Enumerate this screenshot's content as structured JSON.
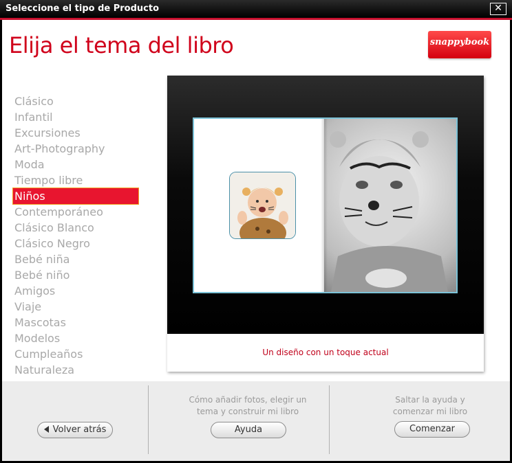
{
  "window": {
    "title": "Seleccione el tipo de Producto",
    "close_glyph": "✕"
  },
  "header": {
    "heading": "Elija el tema del libro",
    "logo_text": "snappybook"
  },
  "themes": {
    "items": [
      "Clásico",
      "Infantil",
      "Excursiones",
      "Art-Photography",
      "Moda",
      "Tiempo libre",
      "Niños",
      "Contemporáneo",
      "Clásico Blanco",
      "Clásico Negro",
      "Bebé niña",
      "Bebé niño",
      "Amigos",
      "Viaje",
      "Mascotas",
      "Modelos",
      "Cumpleaños",
      "Naturaleza"
    ],
    "selected": "Niños"
  },
  "preview": {
    "caption": "Un diseño con un toque actual"
  },
  "footer": {
    "back_label": "Volver atrás",
    "help_text_line1": "Cómo añadir fotos, elegir un",
    "help_text_line2": "tema y construir mi libro",
    "help_label": "Ayuda",
    "skip_text_line1": "Saltar la ayuda y",
    "skip_text_line2": "comenzar mi libro",
    "start_label": "Comenzar"
  },
  "colors": {
    "accent_red": "#d0021b",
    "selected_bg": "#e8152f",
    "book_border": "#7cc3d8"
  }
}
